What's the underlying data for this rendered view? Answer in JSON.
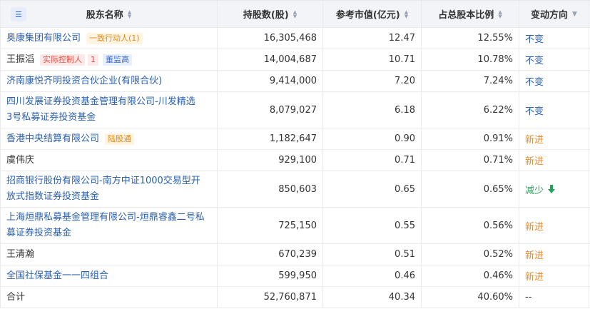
{
  "header": {
    "menu_icon": "list-menu-icon",
    "col_name": "股东名称",
    "col_shares": "持股数(股)",
    "col_value": "参考市值(亿元)",
    "col_ratio": "占总股本比例",
    "col_change": "变动方向"
  },
  "rows": [
    {
      "name": "奥康集团有限公司",
      "tags": [
        "一致行动人(1)"
      ],
      "shares": "16,305,468",
      "value": "12.47",
      "ratio": "12.55%",
      "change": "不变"
    },
    {
      "name": "王振滔",
      "tags": [
        "实际控制人",
        "1",
        "董监高"
      ],
      "shares": "14,004,687",
      "value": "10.71",
      "ratio": "10.78%",
      "change": "不变"
    },
    {
      "name": "济南康悦齐明投资合伙企业(有限合伙)",
      "tags": [],
      "shares": "9,414,000",
      "value": "7.20",
      "ratio": "7.24%",
      "change": "不变"
    },
    {
      "name": "四川发展证券投资基金管理有限公司-川发精选3号私募证券投资基金",
      "tags": [],
      "shares": "8,079,027",
      "value": "6.18",
      "ratio": "6.22%",
      "change": "不变"
    },
    {
      "name": "香港中央结算有限公司",
      "tags": [
        "陆股通"
      ],
      "shares": "1,182,647",
      "value": "0.90",
      "ratio": "0.91%",
      "change": "新进"
    },
    {
      "name": "虞伟庆",
      "tags": [],
      "shares": "929,100",
      "value": "0.71",
      "ratio": "0.71%",
      "change": "新进"
    },
    {
      "name": "招商银行股份有限公司-南方中证1000交易型开放式指数证券投资基金",
      "tags": [],
      "shares": "850,603",
      "value": "0.65",
      "ratio": "0.65%",
      "change": "减少"
    },
    {
      "name": "上海烜鼎私募基金管理有限公司-烜鼎睿鑫二号私募证券投资基金",
      "tags": [],
      "shares": "725,150",
      "value": "0.55",
      "ratio": "0.56%",
      "change": "新进"
    },
    {
      "name": "王清瀚",
      "tags": [],
      "shares": "670,239",
      "value": "0.51",
      "ratio": "0.52%",
      "change": "新进"
    },
    {
      "name": "全国社保基金一一四组合",
      "tags": [],
      "shares": "599,950",
      "value": "0.46",
      "ratio": "0.46%",
      "change": "新进"
    }
  ],
  "total": {
    "name": "合计",
    "shares": "52,760,871",
    "value": "40.34",
    "ratio": "40.60%",
    "change": "--"
  }
}
